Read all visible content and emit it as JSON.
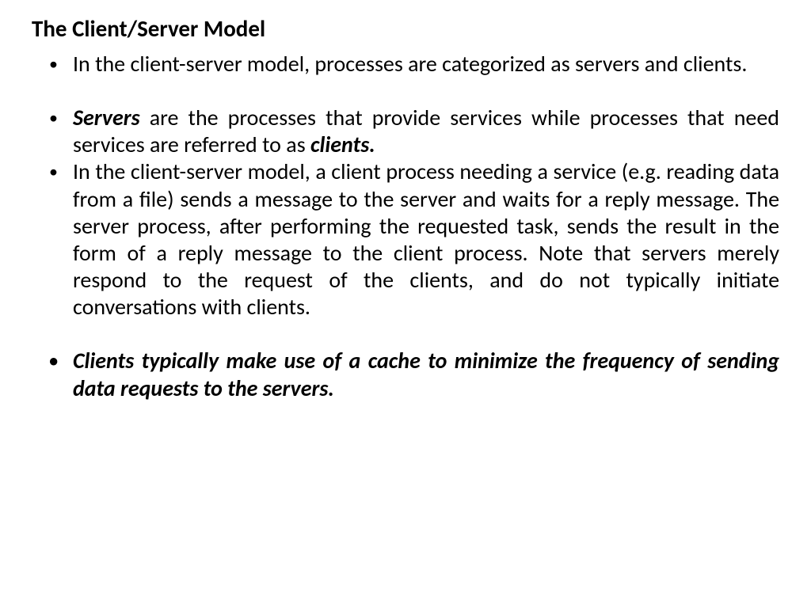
{
  "heading": "The Client/Server Model",
  "bullets": {
    "b1": "In the client-server model, processes are categorized as servers and clients.",
    "b2_lead": "Servers",
    "b2_mid": " are the processes that provide services while processes that need services are referred to as ",
    "b2_end": "clients.",
    "b3": "In the client-server model, a client process needing a service (e.g. reading data from a file) sends a message to the server and waits for a reply message. The server process, after performing the requested task, sends the result in the form of a reply message to the client process. Note that servers merely respond to the request of the clients, and do not typically initiate conversations with clients.",
    "b4": "Clients typically make use of a cache to minimize the frequency of sending data requests to the servers."
  }
}
